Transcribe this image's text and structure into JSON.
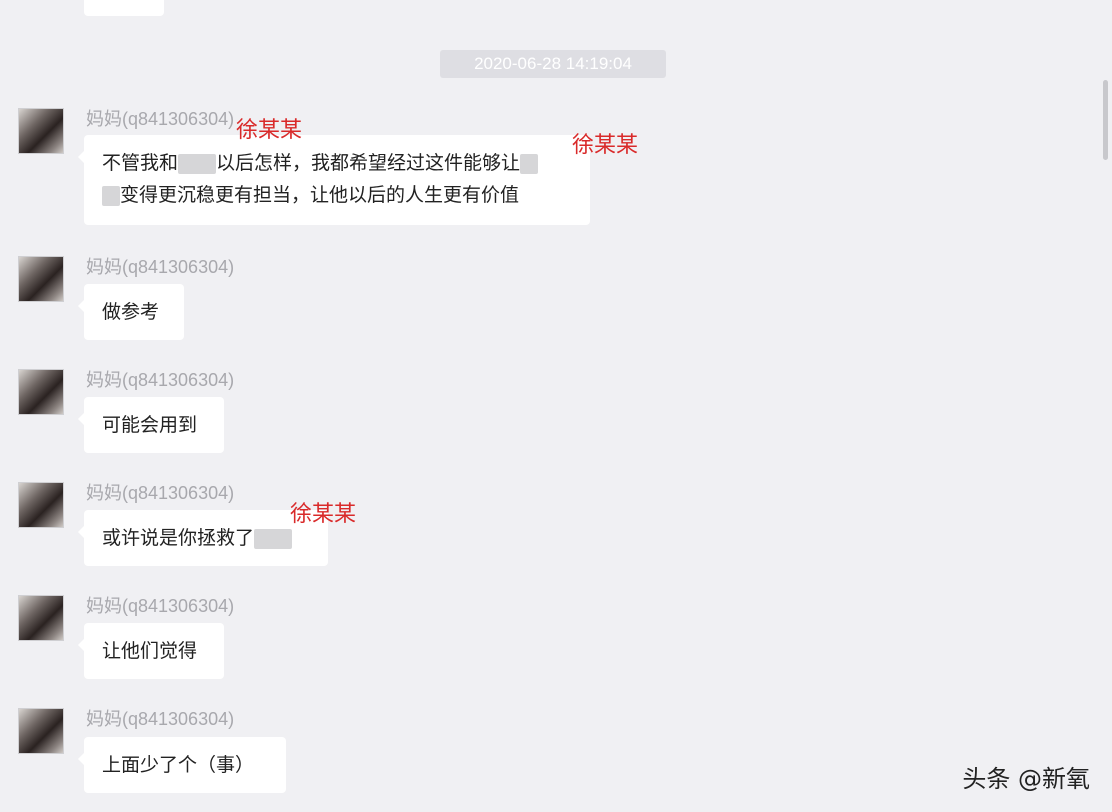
{
  "top_bubble_text": "",
  "timestamp": "2020-06-28 14:19:04",
  "messages": [
    {
      "sender": "妈妈(q841306304)",
      "line1_a": "不管我和",
      "line1_b": "以后怎样，我都希望经过这件能够让",
      "line2": "变得更沉稳更有担当，让他以后的人生更有价值"
    },
    {
      "sender": "妈妈(q841306304)",
      "text": "做参考"
    },
    {
      "sender": "妈妈(q841306304)",
      "text": "可能会用到"
    },
    {
      "sender": "妈妈(q841306304)",
      "text": "或许说是你拯救了"
    },
    {
      "sender": "妈妈(q841306304)",
      "text": "让他们觉得"
    },
    {
      "sender": "妈妈(q841306304)",
      "text": "上面少了个（事）"
    }
  ],
  "annotations": [
    "徐某某",
    "徐某某",
    "徐某某"
  ],
  "watermark": "头条 @新氧",
  "colors": {
    "annotation": "#d92a2a",
    "background": "#f0f0f3",
    "bubble": "#ffffff"
  }
}
